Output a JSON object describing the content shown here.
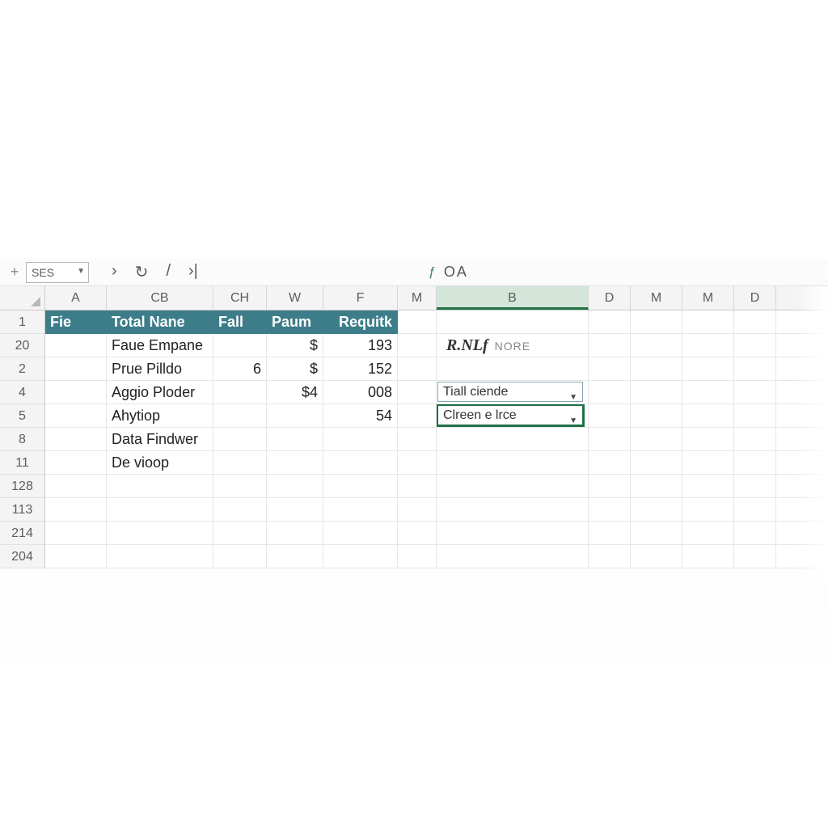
{
  "toolbar": {
    "plus": "+",
    "namebox": "SES",
    "nav": {
      "prev": "›",
      "refresh": "↻",
      "sep": "/",
      "next": "›|"
    },
    "fx_icon": "ƒ",
    "fx_text": "OA"
  },
  "colHeaders": [
    "A",
    "CB",
    "CH",
    "W",
    "F",
    "M",
    "B",
    "D",
    "M",
    "M",
    "D",
    ""
  ],
  "selectedColIndex": 6,
  "rowHeaders": [
    "1",
    "20",
    "2",
    "4",
    "5",
    "8",
    "11",
    "128",
    "113",
    "214",
    "204"
  ],
  "headerRow": {
    "A": "Fie",
    "CB": "Total Nane",
    "CH": "Fall",
    "W": "Paum",
    "F": "Requitk"
  },
  "dataRows": [
    {
      "CB": "Faue Empane",
      "CH": "",
      "W": "$",
      "F": "193"
    },
    {
      "CB": "Prue Pilldo",
      "CH": "6",
      "W": "$",
      "F": "152"
    },
    {
      "CB": "Aggio Ploder",
      "CH": "",
      "W": "$4",
      "F": "008"
    },
    {
      "CB": "Ahytiop",
      "CH": "",
      "W": "",
      "F": "54"
    },
    {
      "CB": "Data Findwer",
      "CH": "",
      "W": "",
      "F": ""
    },
    {
      "CB": "De vioop",
      "CH": "",
      "W": "",
      "F": ""
    }
  ],
  "panel": {
    "title_italic": "R.NLf",
    "title_light": "NORE",
    "drop1": "Tiall ciende",
    "drop2": "Clreen e  lrce"
  }
}
